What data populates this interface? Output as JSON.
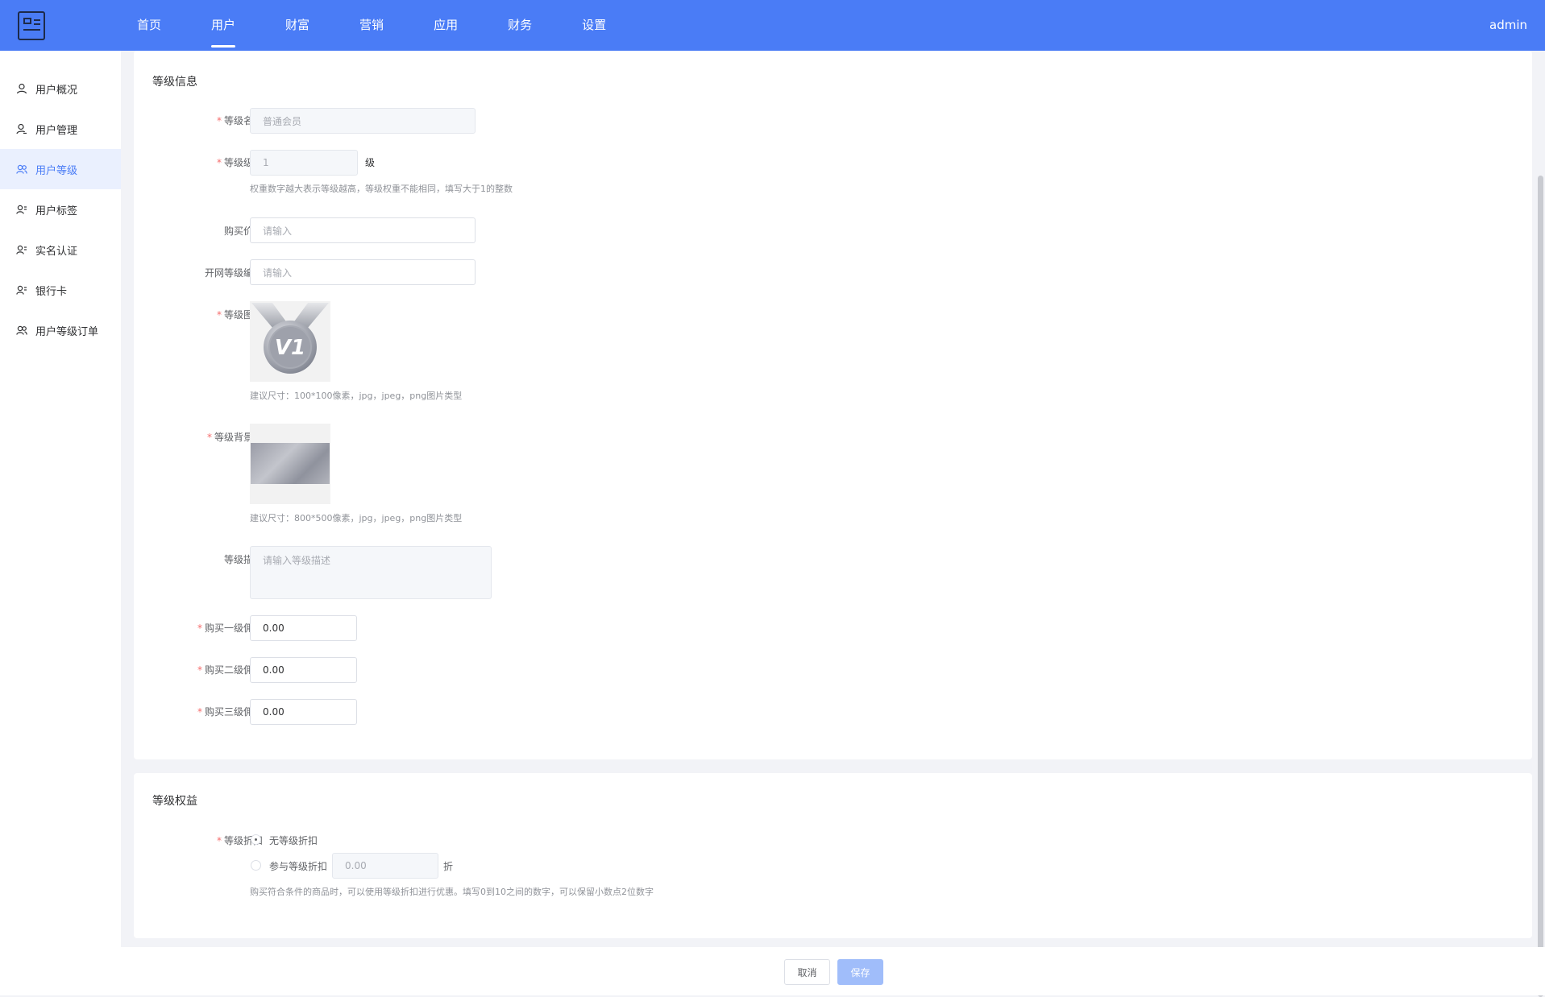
{
  "header": {
    "nav": [
      "首页",
      "用户",
      "财富",
      "营销",
      "应用",
      "财务",
      "设置"
    ],
    "active_nav": "用户",
    "user": "admin"
  },
  "sidebar": {
    "items": [
      "用户概况",
      "用户管理",
      "用户等级",
      "用户标签",
      "实名认证",
      "银行卡",
      "用户等级订单"
    ],
    "active": "用户等级"
  },
  "level_info": {
    "title": "等级信息",
    "name_label": "等级名称",
    "name_value": "普通会员",
    "level_label": "等级级别",
    "level_value": "1",
    "level_unit": "级",
    "level_hint": "权重数字越大表示等级越高，等级权重不能相同，填写大于1的整数",
    "price_label": "购买价格",
    "price_placeholder": "请输入",
    "code_label": "开网等级编号",
    "code_placeholder": "请输入",
    "icon_label": "等级图标",
    "icon_badge_text": "V1",
    "icon_hint": "建议尺寸：100*100像素，jpg，jpeg，png图片类型",
    "bg_label": "等级背景图",
    "bg_hint": "建议尺寸：800*500像素，jpg，jpeg，png图片类型",
    "desc_label": "等级描述",
    "desc_placeholder": "请输入等级描述",
    "commission1_label": "购买一级佣金",
    "commission1_value": "0.00",
    "commission2_label": "购买二级佣金",
    "commission2_value": "0.00",
    "commission3_label": "购买三级佣金",
    "commission3_value": "0.00"
  },
  "level_rights": {
    "title": "等级权益",
    "discount_label": "等级折扣",
    "option_none": "无等级折扣",
    "option_join": "参与等级折扣",
    "discount_value": "0.00",
    "discount_unit": "折",
    "discount_hint": "购买符合条件的商品时，可以使用等级折扣进行优惠。填写0到10之间的数字，可以保留小数点2位数字"
  },
  "footer": {
    "cancel": "取消",
    "save": "保存"
  },
  "colors": {
    "primary": "#4a7cf6",
    "required": "#f56c6c",
    "save_disabled": "#a0bdfa"
  }
}
